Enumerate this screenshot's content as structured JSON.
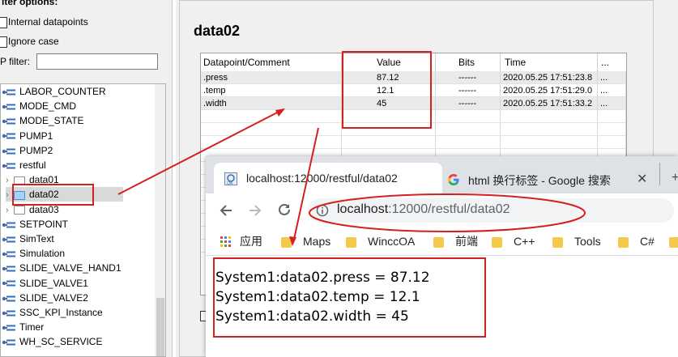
{
  "left_panel": {
    "filter_title": "lter options:",
    "internal_label": "Internal datapoints",
    "ignore_case_label": "Ignore case",
    "dp_filter_label": "P filter:",
    "dp_filter_value": "",
    "tree": [
      {
        "label": "LABOR_COUNTER",
        "kind": "dp"
      },
      {
        "label": "MODE_CMD",
        "kind": "dp"
      },
      {
        "label": "MODE_STATE",
        "kind": "dp"
      },
      {
        "label": "PUMP1",
        "kind": "dp"
      },
      {
        "label": "PUMP2",
        "kind": "dp"
      },
      {
        "label": "restful",
        "kind": "dp-open"
      },
      {
        "label": "data01",
        "kind": "folder"
      },
      {
        "label": "data02",
        "kind": "folder-selected"
      },
      {
        "label": "data03",
        "kind": "folder"
      },
      {
        "label": "SETPOINT",
        "kind": "dp"
      },
      {
        "label": "SimText",
        "kind": "dp"
      },
      {
        "label": "Simulation",
        "kind": "dp"
      },
      {
        "label": "SLIDE_VALVE_HAND1",
        "kind": "dp"
      },
      {
        "label": "SLIDE_VALVE1",
        "kind": "dp"
      },
      {
        "label": "SLIDE_VALVE2",
        "kind": "dp"
      },
      {
        "label": "SSC_KPI_Instance",
        "kind": "dp"
      },
      {
        "label": "Timer",
        "kind": "dp"
      },
      {
        "label": "WH_SC_SERVICE",
        "kind": "dp"
      }
    ]
  },
  "right_panel": {
    "title": "data02",
    "columns": [
      "Datapoint/Comment",
      "Value",
      "Bits",
      "Time",
      "..."
    ],
    "rows": [
      {
        "dp": ".press",
        "value": "87.12",
        "bits": "------",
        "time": "2020.05.25 17:51:23.8",
        "more": "..."
      },
      {
        "dp": ".temp",
        "value": "12.1",
        "bits": "------",
        "time": "2020.05.25 17:51:29.0",
        "more": "..."
      },
      {
        "dp": ".width",
        "value": "45",
        "bits": "------",
        "time": "2020.05.25 17:51:33.2",
        "more": "..."
      }
    ]
  },
  "browser": {
    "tab1_title": "localhost:12000/restful/data02",
    "tab2_title": "html 换行标签 - Google 搜索",
    "url_host": "localhost",
    "url_path": ":12000/restful/data02",
    "bookmarks": [
      "应用",
      "Maps",
      "WinccOA",
      "前端",
      "C++",
      "Tools",
      "C#"
    ],
    "output_lines": [
      "System1:data02.press = 87.12",
      "System1:data02.temp = 12.1",
      "System1:data02.width = 45"
    ]
  },
  "colors": {
    "annotation": "#d42020",
    "selected": "#cce8ff",
    "folder_bookmark": "#f2c94c"
  }
}
